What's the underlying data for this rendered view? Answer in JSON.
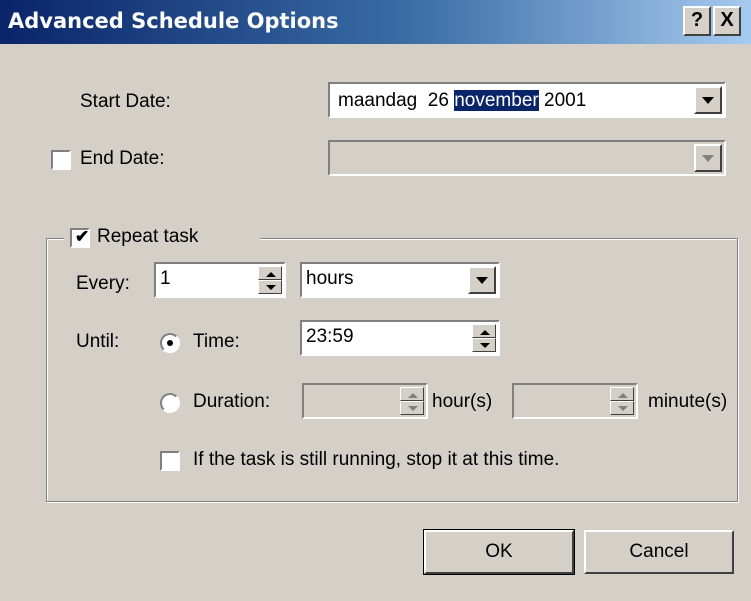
{
  "window": {
    "title": "Advanced Schedule Options",
    "help_glyph": "?",
    "close_glyph": "X"
  },
  "start_date": {
    "label": "Start Date:",
    "value_day": "maandag",
    "value_num": "26",
    "value_month": "november",
    "value_year": "2001"
  },
  "end_date": {
    "label": "End Date:",
    "checked": false,
    "value": ""
  },
  "repeat": {
    "label": "Repeat task",
    "checked": true,
    "check_glyph": "✔",
    "every_label": "Every:",
    "every_value": "1",
    "unit_value": "hours",
    "until_label": "Until:",
    "time_label": "Time:",
    "time_value": "23:59",
    "duration_label": "Duration:",
    "hours_suffix": "hour(s)",
    "minutes_suffix": "minute(s)",
    "stop_label": "If the task is still running, stop it at this time."
  },
  "buttons": {
    "ok": "OK",
    "cancel": "Cancel"
  }
}
